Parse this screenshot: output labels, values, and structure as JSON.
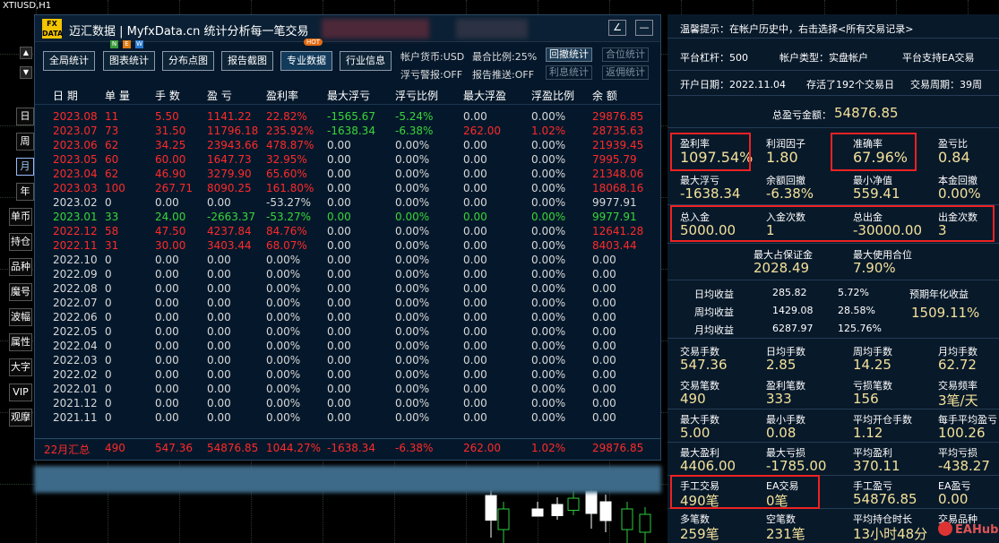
{
  "symbol": "XTIUSD,H1",
  "left_tools": [
    "日",
    "周",
    "月",
    "年",
    "单币",
    "持仓",
    "品种",
    "魔号",
    "波幅",
    "属性",
    "大字",
    "VIP",
    "观摩"
  ],
  "left_tools_selected": "月",
  "title": "迈汇数据 | MyfxData.cn  统计分析每一笔交易",
  "logo": {
    "top": "FX",
    "bottom": "DATA"
  },
  "toolbar": {
    "buttons": [
      "全局统计",
      "图表统计",
      "分布点图",
      "报告截图",
      "专业数据",
      "行业信息"
    ],
    "hot_badge": "HOT",
    "new_letters": [
      "N",
      "E",
      "W"
    ],
    "currency": "帐户货币:USD",
    "max_margin": "最合比例:25%",
    "float_alert": "浮亏警报:OFF",
    "report_push": "报告推送:OFF",
    "small_buttons": [
      "回撤统计",
      "合位统计",
      "利息统计",
      "返佣统计"
    ]
  },
  "columns": [
    "日 期",
    "单 量",
    "手 数",
    "盈 亏",
    "盈利率",
    "最大浮亏",
    "浮亏比例",
    "最大浮盈",
    "浮盈比例",
    "余 额"
  ],
  "rows": [
    {
      "c": [
        "2023.08",
        "11",
        "5.50",
        "1141.22",
        "22.82%",
        "-1565.67",
        "-5.24%",
        "0.00",
        "0.00%",
        "29876.85"
      ],
      "cls": "red"
    },
    {
      "c": [
        "2023.07",
        "73",
        "31.50",
        "11796.18",
        "235.92%",
        "-1638.34",
        "-6.38%",
        "262.00",
        "1.02%",
        "28735.63"
      ],
      "cls": "red"
    },
    {
      "c": [
        "2023.06",
        "62",
        "34.25",
        "23943.66",
        "478.87%",
        "0.00",
        "0.00%",
        "0.00",
        "0.00%",
        "21939.45"
      ],
      "cls": "red"
    },
    {
      "c": [
        "2023.05",
        "60",
        "60.00",
        "1647.73",
        "32.95%",
        "0.00",
        "0.00%",
        "0.00",
        "0.00%",
        "7995.79"
      ],
      "cls": "red"
    },
    {
      "c": [
        "2023.04",
        "62",
        "46.90",
        "3279.90",
        "65.60%",
        "0.00",
        "0.00%",
        "0.00",
        "0.00%",
        "21348.06"
      ],
      "cls": "red"
    },
    {
      "c": [
        "2023.03",
        "100",
        "267.71",
        "8090.25",
        "161.80%",
        "0.00",
        "0.00%",
        "0.00",
        "0.00%",
        "18068.16"
      ],
      "cls": "red"
    },
    {
      "c": [
        "2023.02",
        "0",
        "0.00",
        "0.00",
        "-53.27%",
        "0.00",
        "0.00%",
        "0.00",
        "0.00%",
        "9977.91"
      ],
      "cls": "white"
    },
    {
      "c": [
        "2023.01",
        "33",
        "24.00",
        "-2663.37",
        "-53.27%",
        "0.00",
        "0.00%",
        "0.00",
        "0.00%",
        "9977.91"
      ],
      "cls": "green"
    },
    {
      "c": [
        "2022.12",
        "58",
        "47.50",
        "4237.84",
        "84.76%",
        "0.00",
        "0.00%",
        "0.00",
        "0.00%",
        "12641.28"
      ],
      "cls": "red"
    },
    {
      "c": [
        "2022.11",
        "31",
        "30.00",
        "3403.44",
        "68.07%",
        "0.00",
        "0.00%",
        "0.00",
        "0.00%",
        "8403.44"
      ],
      "cls": "red"
    },
    {
      "c": [
        "2022.10",
        "0",
        "0.00",
        "0.00",
        "0.00%",
        "0.00",
        "0.00%",
        "0.00",
        "0.00%",
        "0.00"
      ],
      "cls": "white"
    },
    {
      "c": [
        "2022.09",
        "0",
        "0.00",
        "0.00",
        "0.00%",
        "0.00",
        "0.00%",
        "0.00",
        "0.00%",
        "0.00"
      ],
      "cls": "white"
    },
    {
      "c": [
        "2022.08",
        "0",
        "0.00",
        "0.00",
        "0.00%",
        "0.00",
        "0.00%",
        "0.00",
        "0.00%",
        "0.00"
      ],
      "cls": "white"
    },
    {
      "c": [
        "2022.07",
        "0",
        "0.00",
        "0.00",
        "0.00%",
        "0.00",
        "0.00%",
        "0.00",
        "0.00%",
        "0.00"
      ],
      "cls": "white"
    },
    {
      "c": [
        "2022.06",
        "0",
        "0.00",
        "0.00",
        "0.00%",
        "0.00",
        "0.00%",
        "0.00",
        "0.00%",
        "0.00"
      ],
      "cls": "white"
    },
    {
      "c": [
        "2022.05",
        "0",
        "0.00",
        "0.00",
        "0.00%",
        "0.00",
        "0.00%",
        "0.00",
        "0.00%",
        "0.00"
      ],
      "cls": "white"
    },
    {
      "c": [
        "2022.04",
        "0",
        "0.00",
        "0.00",
        "0.00%",
        "0.00",
        "0.00%",
        "0.00",
        "0.00%",
        "0.00"
      ],
      "cls": "white"
    },
    {
      "c": [
        "2022.03",
        "0",
        "0.00",
        "0.00",
        "0.00%",
        "0.00",
        "0.00%",
        "0.00",
        "0.00%",
        "0.00"
      ],
      "cls": "white"
    },
    {
      "c": [
        "2022.02",
        "0",
        "0.00",
        "0.00",
        "0.00%",
        "0.00",
        "0.00%",
        "0.00",
        "0.00%",
        "0.00"
      ],
      "cls": "white"
    },
    {
      "c": [
        "2022.01",
        "0",
        "0.00",
        "0.00",
        "0.00%",
        "0.00",
        "0.00%",
        "0.00",
        "0.00%",
        "0.00"
      ],
      "cls": "white"
    },
    {
      "c": [
        "2021.12",
        "0",
        "0.00",
        "0.00",
        "0.00%",
        "0.00",
        "0.00%",
        "0.00",
        "0.00%",
        "0.00"
      ],
      "cls": "white"
    },
    {
      "c": [
        "2021.11",
        "0",
        "0.00",
        "0.00",
        "0.00%",
        "0.00",
        "0.00%",
        "0.00",
        "0.00%",
        "0.00"
      ],
      "cls": "white"
    }
  ],
  "summary": [
    "22月汇总",
    "490",
    "547.36",
    "54876.85",
    "1044.27%",
    "-1638.34",
    "-6.38%",
    "262.00",
    "1.02%",
    "29876.85"
  ],
  "right": {
    "tip": "温馨提示：在帐户历史中，右击选择<所有交易记录>",
    "leverage": "平台杠杆：500",
    "acct_type": "帐户类型：实盘帐户",
    "ea_support": "平台支持EA交易",
    "open_date": "开户日期：2022.11.04",
    "days": "存活了192个交易日",
    "period": "交易周期：39周",
    "total_label": "总盈亏金额：",
    "total_value": "54876.85",
    "stats1": [
      [
        "盈利率",
        "1097.54%"
      ],
      [
        "利润因子",
        "1.80"
      ],
      [
        "准确率",
        "67.96%"
      ],
      [
        "盈亏比",
        "0.84"
      ]
    ],
    "stats2": [
      [
        "最大浮亏",
        "-1638.34"
      ],
      [
        "余额回撤",
        "-6.38%"
      ],
      [
        "最小净值",
        "559.41"
      ],
      [
        "本金回撤",
        "0.00%"
      ]
    ],
    "stats3": [
      [
        "总入金",
        "5000.00"
      ],
      [
        "入金次数",
        "1"
      ],
      [
        "总出金",
        "-30000.00"
      ],
      [
        "出金次数",
        "3"
      ]
    ],
    "margin": [
      [
        "最大占保证金",
        "2028.49"
      ],
      [
        "最大使用合位",
        "7.90%"
      ]
    ],
    "avg": [
      [
        "日均收益",
        "285.82",
        "5.72%"
      ],
      [
        "周均收益",
        "1429.08",
        "28.58%"
      ],
      [
        "月均收益",
        "6287.97",
        "125.76%"
      ]
    ],
    "annual_label": "预期年化收益",
    "annual_value": "1509.11%",
    "stats4": [
      [
        "交易手数",
        "547.36"
      ],
      [
        "日均手数",
        "2.85"
      ],
      [
        "周均手数",
        "14.25"
      ],
      [
        "月均手数",
        "62.72"
      ]
    ],
    "stats5": [
      [
        "交易笔数",
        "490"
      ],
      [
        "盈利笔数",
        "333"
      ],
      [
        "亏损笔数",
        "156"
      ],
      [
        "交易频率",
        "3笔/天"
      ]
    ],
    "stats6": [
      [
        "最大手数",
        "5.00"
      ],
      [
        "最小手数",
        "0.08"
      ],
      [
        "平均开仓手数",
        "1.12"
      ],
      [
        "每手平均盈亏",
        "100.26"
      ]
    ],
    "stats7": [
      [
        "最大盈利",
        "4406.00"
      ],
      [
        "最大亏损",
        "-1785.00"
      ],
      [
        "平均盈利",
        "370.11"
      ],
      [
        "平均亏损",
        "-438.27"
      ]
    ],
    "stats8": [
      [
        "手工交易",
        "490笔"
      ],
      [
        "EA交易",
        "0笔"
      ],
      [
        "手工盈亏",
        "54876.85"
      ],
      [
        "EA盈亏",
        "0.00"
      ]
    ],
    "stats9": [
      [
        "多笔数",
        "259笔"
      ],
      [
        "空笔数",
        "231笔"
      ],
      [
        "平均持仓时长",
        "13小时48分"
      ],
      [
        "交易品种",
        ""
      ]
    ],
    "watermark": "EAHub"
  }
}
